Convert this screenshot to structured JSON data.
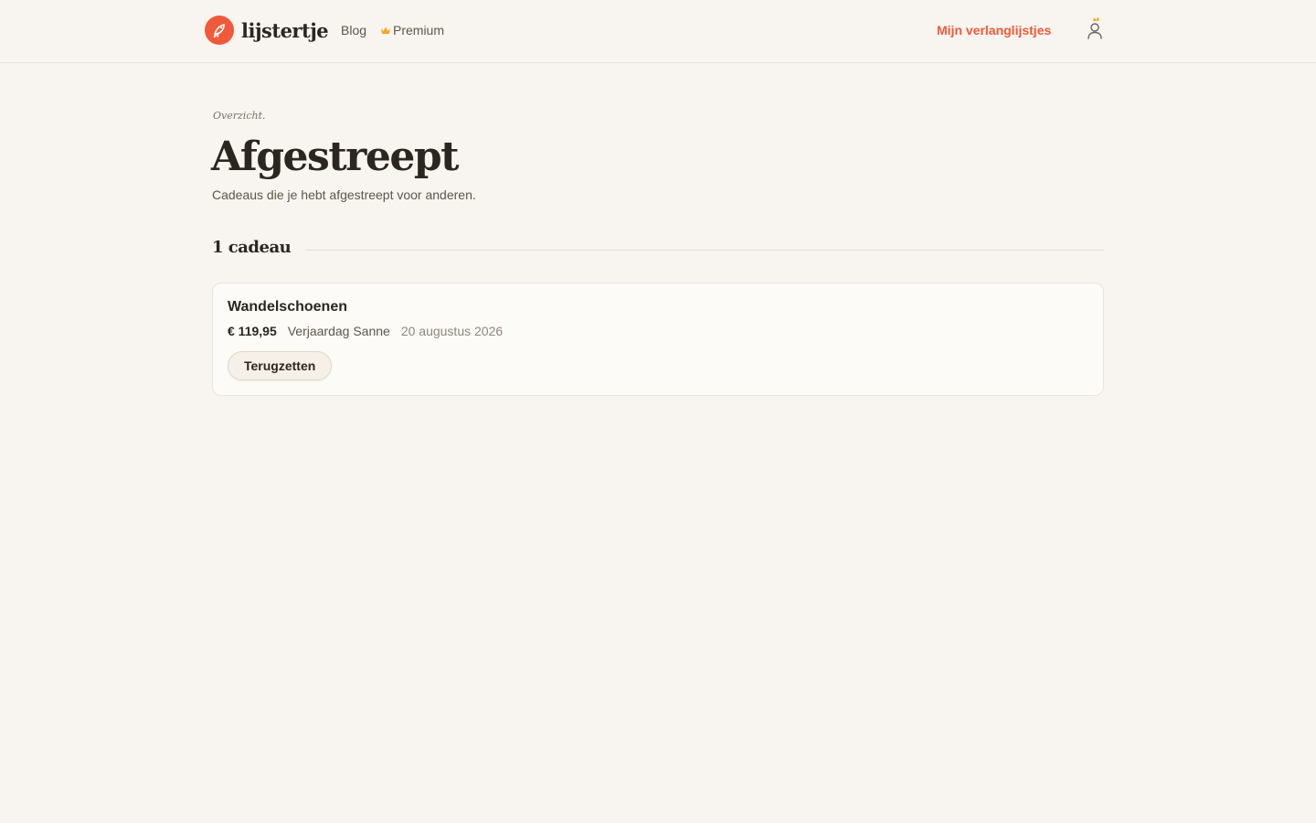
{
  "header": {
    "brand_name": "lijstertje",
    "nav": {
      "blog": "Blog",
      "premium": "Premium"
    },
    "my_lists": "Mijn verlanglijstjes",
    "accent_color": "#f05a3a",
    "crown_color": "#f5a623"
  },
  "page": {
    "eyebrow": "Overzicht.",
    "title": "Afgestreept",
    "subtitle": "Cadeaus die je hebt afgestreept voor anderen."
  },
  "section": {
    "count_label": "1 cadeau"
  },
  "items": [
    {
      "title": "Wandelschoenen",
      "price": "€ 119,95",
      "list": "Verjaardag Sanne",
      "date": "20 augustus 2026",
      "action": "Terugzetten"
    }
  ]
}
